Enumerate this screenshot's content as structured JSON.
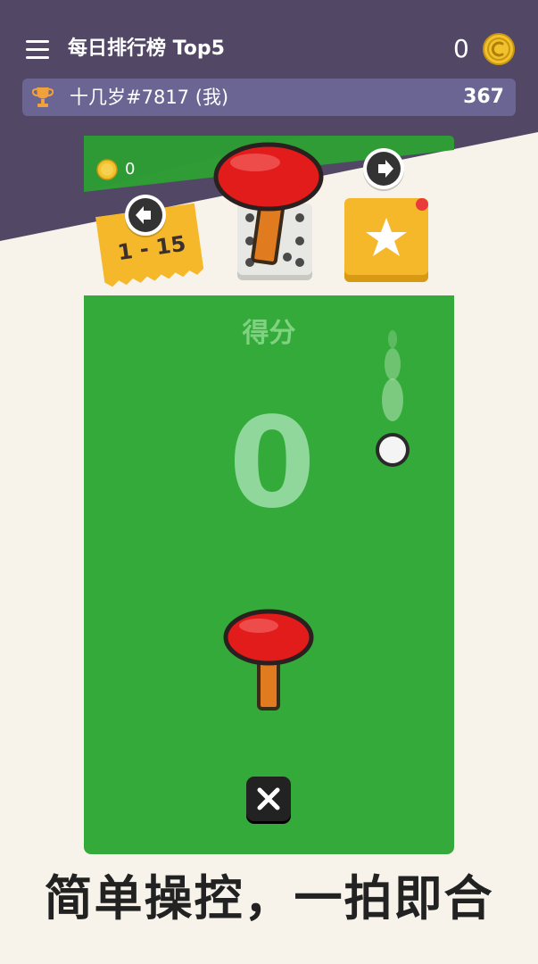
{
  "header": {
    "title": "每日排行榜 Top5",
    "coins": "0"
  },
  "rank": {
    "name": "十几岁#7817 (我)",
    "score": "367"
  },
  "shop": {
    "coins": "0"
  },
  "level": {
    "label": "1 - 15"
  },
  "game": {
    "score_label": "得分",
    "score": "0"
  },
  "tagline": "简单操控，一拍即合",
  "colors": {
    "header_bg": "#524866",
    "field_green": "#33aa3a",
    "paddle_red": "#e21b1b",
    "coin_gold": "#f2c12e",
    "star_tile": "#f5b82a"
  }
}
